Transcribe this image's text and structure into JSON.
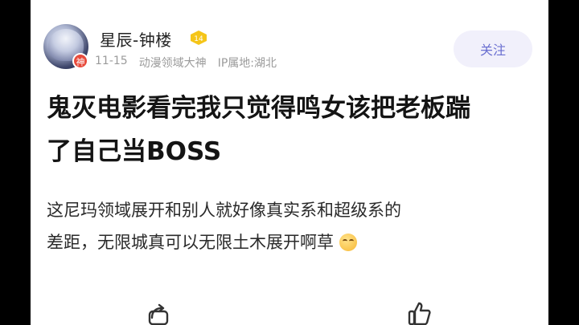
{
  "post": {
    "author": {
      "name": "星辰-钟楼",
      "level": "14",
      "god_badge": "神"
    },
    "meta": {
      "date": "11-15",
      "title_tag": "动漫领域大神",
      "ip_location": "IP属地:湖北"
    },
    "follow_label": "关注",
    "title_line1": "鬼灭电影看完我只觉得鸣女该把老板踹",
    "title_line2": "了自己当BOSS",
    "body_line1": "这尼玛领域展开和别人就好像真实系和超级系的",
    "body_line2": "差距，无限城真可以无限土木展开啊草",
    "emoji_icon": "grinning-squint-emoji",
    "actions": [
      "share-icon",
      "like-icon"
    ],
    "colors": {
      "accent": "#6a6fd1",
      "follow_bg": "#f1f0fb",
      "level_badge": "#f5c518",
      "god_badge": "#e84a3b"
    }
  }
}
